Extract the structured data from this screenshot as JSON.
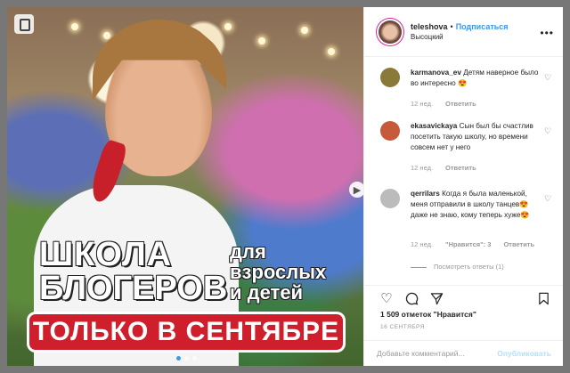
{
  "post_image": {
    "headline_line1": "ШКОЛА",
    "headline_line2": "БЛОГЕРОВ",
    "side_text": [
      "для",
      "взрослых",
      "и детей"
    ],
    "banner": "ТОЛЬКО В СЕНТЯБРЕ",
    "carousel_dots": 3
  },
  "header": {
    "username": "teleshova",
    "separator": "•",
    "follow_label": "Подписаться",
    "location": "Высоцкий",
    "more_label": "•••"
  },
  "comments": [
    {
      "username": "karmanova_ev",
      "text": "Детям наверное было во интересно 😍",
      "age": "12 нед.",
      "reply_label": "Ответить",
      "likes": "",
      "avatar_color": "#8a7a3a"
    },
    {
      "username": "ekasavickaya",
      "text": "Сын был бы счастлив посетить такую школу, но времени совсем нет у него",
      "age": "12 нед.",
      "reply_label": "Ответить",
      "likes": "",
      "avatar_color": "#c65a3a"
    },
    {
      "username": "qerrilars",
      "text": "Когда я была маленькой, меня отправили в школу танцев😍 даже не знаю, кому теперь хуже😍",
      "age": "12 нед.",
      "reply_label": "Ответить",
      "likes": "\"Нравится\": 3",
      "avatar_color": "#bbbbbb"
    }
  ],
  "view_replies": "Посмотреть ответы (1)",
  "actions": {
    "like_icon": "heart-icon",
    "comment_icon": "comment-icon",
    "share_icon": "share-icon",
    "save_icon": "bookmark-icon"
  },
  "likes_count": "1 509",
  "likes_label": "отметок \"Нравится\"",
  "date": "16 СЕНТЯБРЯ",
  "add_comment": {
    "placeholder": "Добавьте комментарий...",
    "publish_label": "Опубликовать"
  },
  "colors": {
    "accent": "#3897f0",
    "banner_red": "#d01f2c",
    "publish_disabled": "#b2dffc"
  }
}
